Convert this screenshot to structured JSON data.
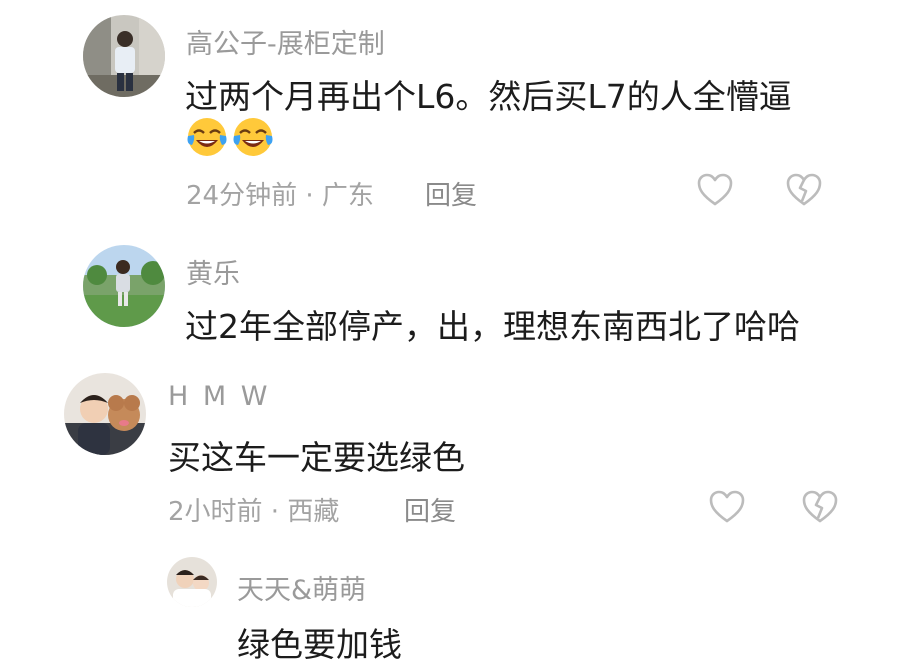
{
  "comments": [
    {
      "username": "高公子-展柜定制",
      "text": "过两个月再出个L6。然后买L7的人全懵逼",
      "emojis": [
        "tears-of-joy-emoji",
        "tears-of-joy-emoji"
      ],
      "time": "24分钟前",
      "location": "广东",
      "reply_label": "回复"
    },
    {
      "username": "黄乐",
      "text": "过2年全部停产，出，理想东南西北了哈哈"
    },
    {
      "username": "H M W",
      "text": "买这车一定要选绿色",
      "time": "2小时前",
      "location": "西藏",
      "reply_label": "回复",
      "reply": {
        "username": "天天&萌萌",
        "text": "绿色要加钱"
      }
    }
  ],
  "meta_separator": " · ",
  "icons": {
    "like": "heart-outline-icon",
    "dislike": "broken-heart-icon"
  },
  "colors": {
    "username": "#9a9a9a",
    "text": "#1c1c1c",
    "meta": "#a3a3a3",
    "icon": "#bcbcbc"
  }
}
